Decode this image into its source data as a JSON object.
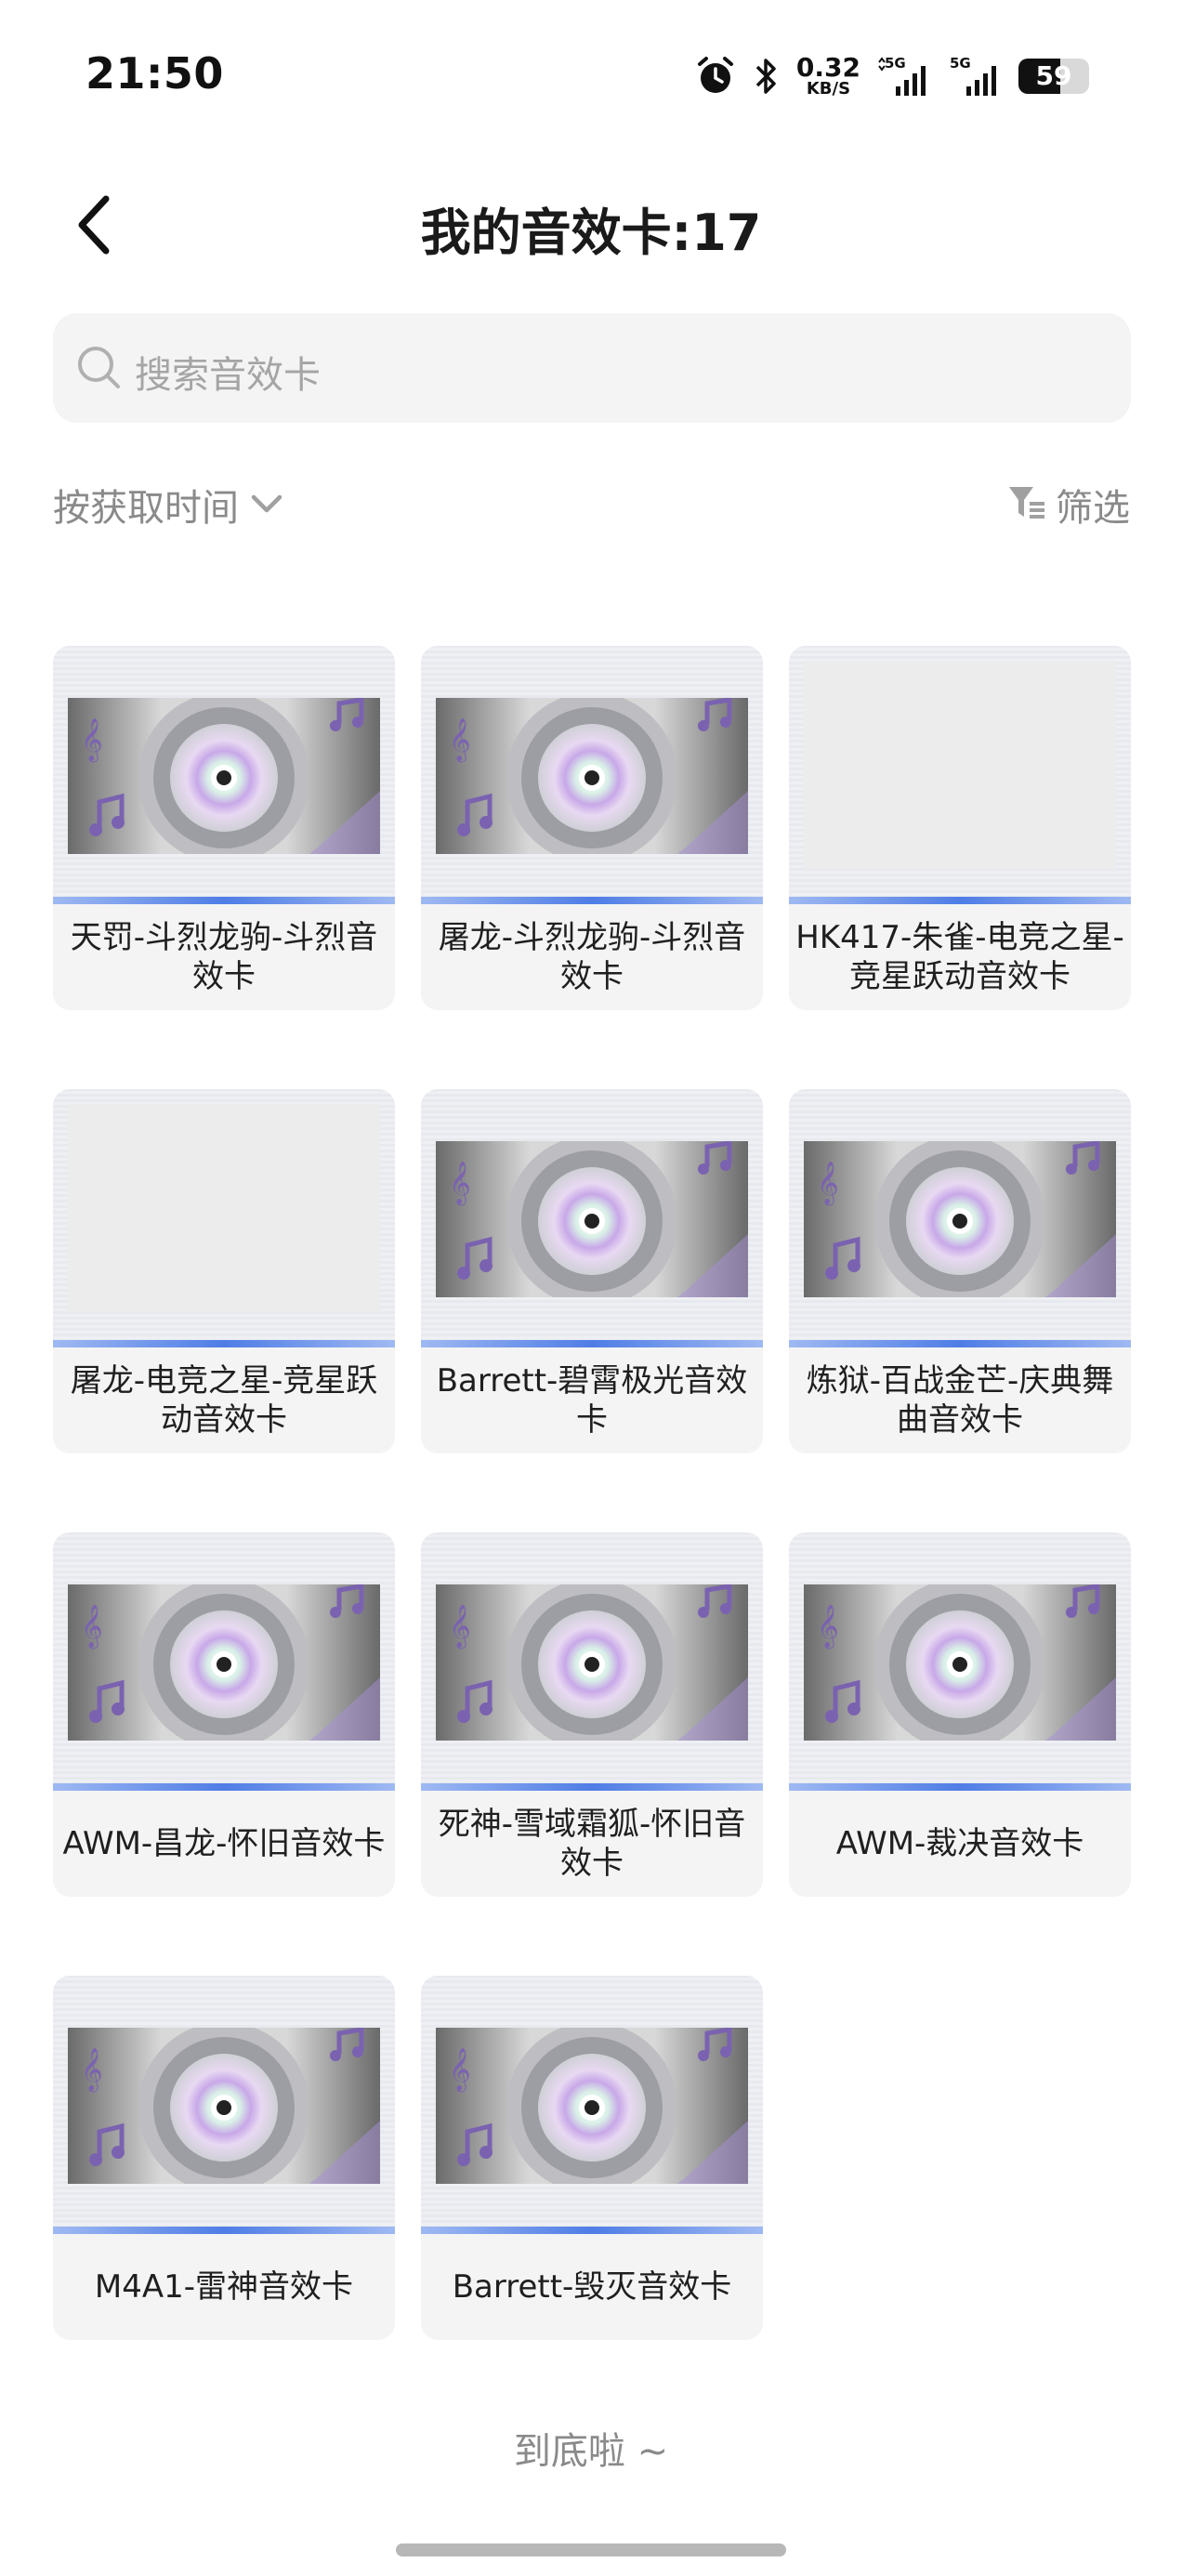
{
  "status_bar": {
    "time": "21:50",
    "net_speed_value": "0.32",
    "net_speed_unit": "KB/S",
    "network1": "5G",
    "network2": "5G",
    "battery": "59",
    "icons": [
      "alarm-icon",
      "bluetooth-icon",
      "signal-icon",
      "battery-icon"
    ]
  },
  "header": {
    "title": "我的音效卡:17",
    "back_icon": "chevron-left-icon"
  },
  "search": {
    "placeholder": "搜索音效卡"
  },
  "toolbar": {
    "sort_label": "按获取时间",
    "filter_label": "筛选"
  },
  "cards": [
    {
      "label": "天罚-斗烈龙驹-斗烈音效卡",
      "thumb": "disc"
    },
    {
      "label": "屠龙-斗烈龙驹-斗烈音效卡",
      "thumb": "disc"
    },
    {
      "label": "HK417-朱雀-电竞之星-竞星跃动音效卡",
      "thumb": "blank"
    },
    {
      "label": "屠龙-电竞之星-竞星跃动音效卡",
      "thumb": "blank"
    },
    {
      "label": "Barrett-碧霄极光音效卡",
      "thumb": "disc"
    },
    {
      "label": "炼狱-百战金芒-庆典舞曲音效卡",
      "thumb": "disc"
    },
    {
      "label": "AWM-昌龙-怀旧音效卡",
      "thumb": "disc"
    },
    {
      "label": "死神-雪域霜狐-怀旧音效卡",
      "thumb": "disc"
    },
    {
      "label": "AWM-裁决音效卡",
      "thumb": "disc"
    },
    {
      "label": "M4A1-雷神音效卡",
      "thumb": "disc"
    },
    {
      "label": "Barrett-毁灭音效卡",
      "thumb": "disc"
    }
  ],
  "footer": {
    "end_text": "到底啦 ~"
  },
  "colors": {
    "accent_blue": "#4f7de6",
    "card_bg": "#f4f4f4",
    "muted_text": "#8a8a8a"
  }
}
